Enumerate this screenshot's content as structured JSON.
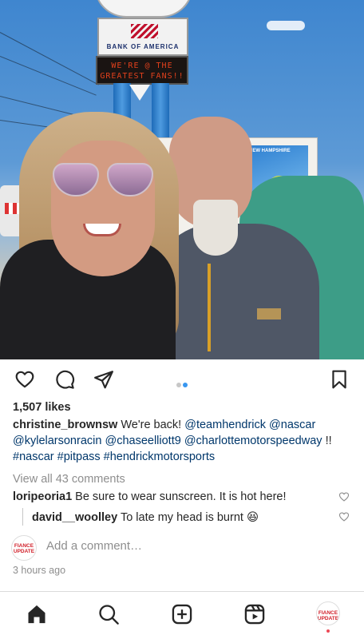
{
  "post": {
    "photo": {
      "bank_sign_text": "BANK OF AMERICA",
      "led_line1": "WE'RE @ THE",
      "led_line2": "GREATEST FANS!!",
      "truck_art_text": "NEW HAMPSHIRE"
    },
    "actions": {
      "like_icon": "heart-outline-icon",
      "comment_icon": "comment-bubble-icon",
      "share_icon": "paper-plane-icon",
      "save_icon": "bookmark-outline-icon",
      "carousel_count": 2,
      "carousel_active_index": 1,
      "dot_active_color": "#3897f0",
      "dot_inactive_color": "#c7c7c7"
    },
    "likes": "1,507 likes",
    "caption": {
      "username": "christine_brownsw",
      "text": "We're back!",
      "mentions": [
        "@teamhendrick",
        "@nascar",
        "@kylelarsonracin",
        "@chaseelliott9",
        "@charlottemotorspeedway"
      ],
      "trailing": "!!",
      "hashtags": [
        "#nascar",
        "#pitpass",
        "#hendrickmotorsports"
      ]
    },
    "view_all_comments": "View all 43 comments",
    "comments": [
      {
        "username": "loripeoria1",
        "text": "Be sure to wear sunscreen. It is hot here!"
      },
      {
        "username": "david__woolley",
        "text": "To late my head is burnt 😆"
      }
    ],
    "add_comment_avatar_text": "FIANCE UPDATE",
    "add_comment_placeholder": "Add a comment…",
    "time_ago": "3 hours ago"
  },
  "tabbar": {
    "home_icon": "home-icon",
    "search_icon": "search-icon",
    "create_icon": "plus-square-icon",
    "reels_icon": "reels-icon",
    "profile_avatar_text": "FIANCE UPDATE",
    "notification_color": "#ed4956"
  }
}
